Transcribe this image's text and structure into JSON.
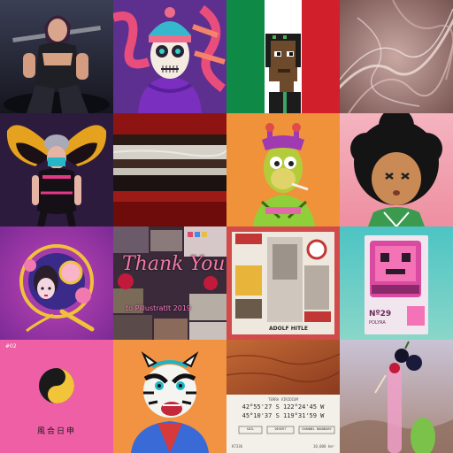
{
  "gallery": {
    "tiles": [
      {
        "art": "warrior-woman-art",
        "bg": "#2a2c3a"
      },
      {
        "art": "sugar-skull-hoodie-art",
        "bg": "#5b2a8a"
      },
      {
        "art": "pixel-punk-mexico-art",
        "bg": "#ffffff"
      },
      {
        "art": "smoke-abstract-art",
        "bg": "#b08e88"
      },
      {
        "art": "butterfly-woman-art",
        "bg": "#2c1b3c"
      },
      {
        "art": "striped-painting-art",
        "bg": "#7a0f0f"
      },
      {
        "art": "giraffe-ape-art",
        "bg": "#f0923a"
      },
      {
        "art": "afro-boy-art",
        "bg": "#f2a9b5"
      },
      {
        "art": "geisha-50-art",
        "bg": "#b03aa8"
      },
      {
        "art": "thank-you-collage-art",
        "bg": "#3a2a3a",
        "text_line1": "Thank You",
        "text_line2": "to PillustratIt 2019"
      },
      {
        "art": "vintage-poster-collage-art",
        "bg": "#d24a4a",
        "text": "ADOLF HITLE"
      },
      {
        "art": "pink-robot-card-art",
        "bg": "#5cc6c8",
        "number": "Nº29",
        "label": "POLYRA"
      },
      {
        "art": "yin-yang-art",
        "bg": "#ee5fa5",
        "corner": "#02",
        "caption": "風合日申"
      },
      {
        "art": "tiger-mascot-art",
        "bg": "#f29243"
      },
      {
        "art": "terra-coordinates-art",
        "bg": "#b4582a",
        "header": "TERRA VIRIDIUM",
        "coord_line1": "42°55'27 S 122°24'45 W",
        "coord_line2": "45°10'37 S 119°31'59 W",
        "btn1": "SOIL",
        "btn2": "DESERT",
        "btn3": "CHANNEL BOUNDARY",
        "footer_left": "K7336",
        "footer_right": "10,000 km²"
      },
      {
        "art": "cherry-cactus-art",
        "bg": "#c7bfcc"
      }
    ]
  }
}
